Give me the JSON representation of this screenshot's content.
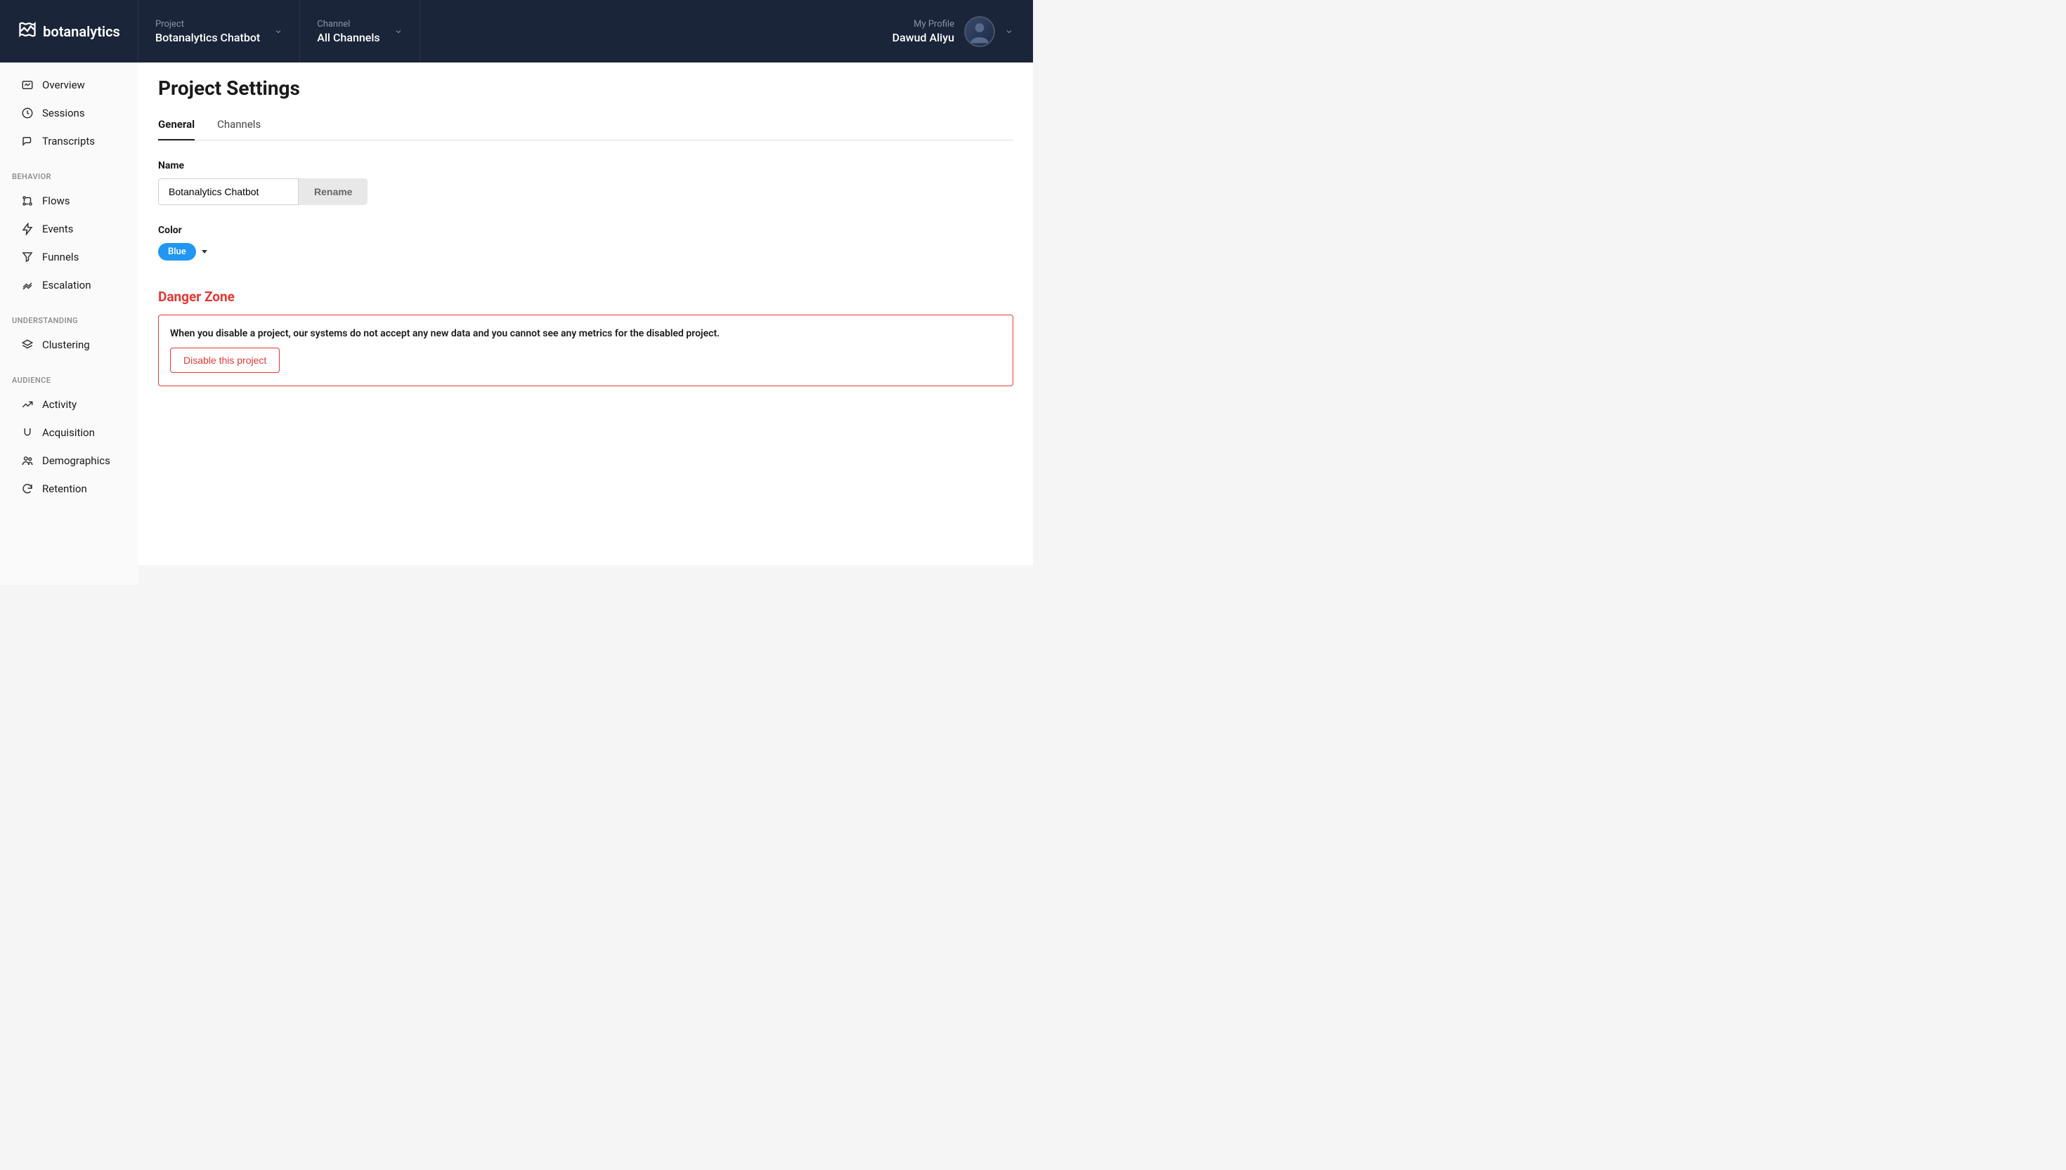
{
  "brand": "botanalytics",
  "header": {
    "project_label": "Project",
    "project_value": "Botanalytics Chatbot",
    "channel_label": "Channel",
    "channel_value": "All Channels",
    "profile_label": "My Profile",
    "profile_value": "Dawud Aliyu"
  },
  "sidebar": {
    "items_top": [
      {
        "label": "Overview"
      },
      {
        "label": "Sessions"
      },
      {
        "label": "Transcripts"
      }
    ],
    "section_behavior": "BEHAVIOR",
    "items_behavior": [
      {
        "label": "Flows"
      },
      {
        "label": "Events"
      },
      {
        "label": "Funnels"
      },
      {
        "label": "Escalation"
      }
    ],
    "section_understanding": "UNDERSTANDING",
    "items_understanding": [
      {
        "label": "Clustering"
      }
    ],
    "section_audience": "AUDIENCE",
    "items_audience": [
      {
        "label": "Activity"
      },
      {
        "label": "Acquisition"
      },
      {
        "label": "Demographics"
      },
      {
        "label": "Retention"
      }
    ]
  },
  "main": {
    "title": "Project Settings",
    "tabs": {
      "general": "General",
      "channels": "Channels"
    },
    "name_label": "Name",
    "name_value": "Botanalytics Chatbot",
    "rename_label": "Rename",
    "color_label": "Color",
    "color_value": "Blue",
    "color_hex": "#2196f3",
    "danger_title": "Danger Zone",
    "danger_text": "When you disable a project, our systems do not accept any new data and you cannot see any metrics for the disabled project.",
    "disable_label": "Disable this project"
  }
}
